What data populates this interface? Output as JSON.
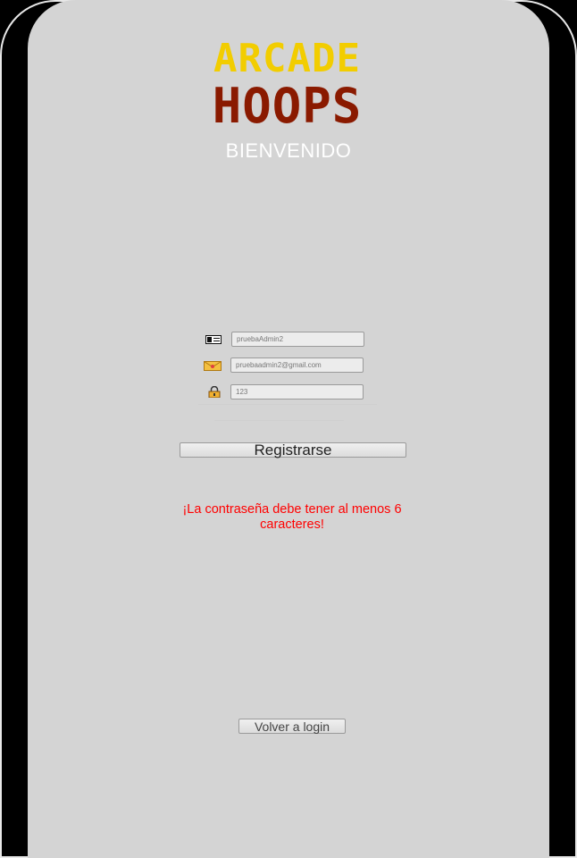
{
  "logo": {
    "line1": "ARCADE",
    "line2": "HOOPS",
    "colors": {
      "line1": "#f2cd00",
      "line2": "#8a1a00"
    }
  },
  "welcome": "BIENVENIDO",
  "form": {
    "username": {
      "value": "pruebaAdmin2",
      "icon": "id-card-icon"
    },
    "email": {
      "value": "pruebaadmin2@gmail.com",
      "icon": "envelope-icon"
    },
    "password": {
      "value": "123",
      "icon": "lock-icon"
    },
    "submit_label": "Registrarse"
  },
  "error_message": "¡La contraseña debe tener al menos 6 caracteres!",
  "back_label": "Volver a login",
  "colors": {
    "panel": "#d4d4d4",
    "background": "#000000",
    "error": "#ff0000",
    "welcome": "#ffffff"
  }
}
